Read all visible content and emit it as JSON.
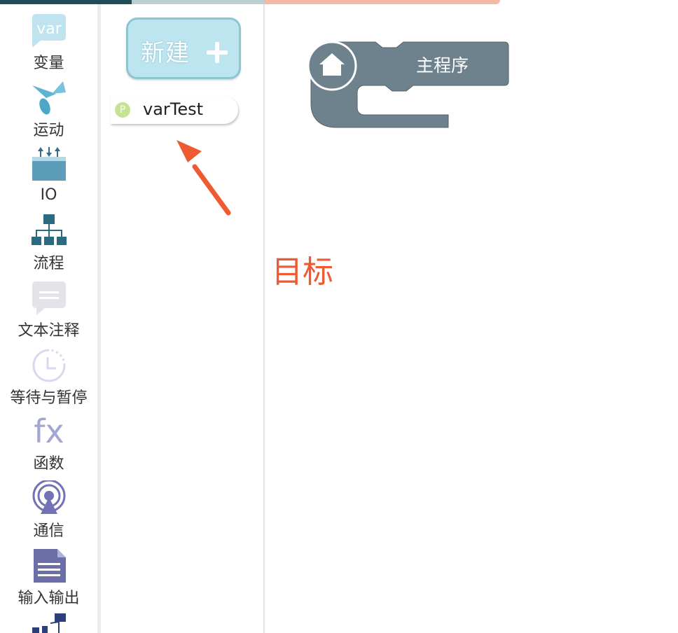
{
  "sidebar": {
    "categories": [
      {
        "label": "变量",
        "icon": "var-icon"
      },
      {
        "label": "运动",
        "icon": "motion-icon"
      },
      {
        "label": "IO",
        "icon": "io-icon"
      },
      {
        "label": "流程",
        "icon": "flow-icon"
      },
      {
        "label": "文本注释",
        "icon": "comment-icon"
      },
      {
        "label": "等待与暂停",
        "icon": "clock-icon"
      },
      {
        "label": "函数",
        "icon": "function-icon"
      },
      {
        "label": "通信",
        "icon": "antenna-icon"
      },
      {
        "label": "输入输出",
        "icon": "document-icon"
      }
    ],
    "var_icon_text": "var",
    "function_icon_text": "fx"
  },
  "palette": {
    "new_button_label": "新建",
    "variable": {
      "badge": "P",
      "name": "varTest"
    }
  },
  "workspace": {
    "main_block_label": "主程序",
    "annotation_label": "目标"
  },
  "colors": {
    "accent": "#ee5a32",
    "block": "#6d828d",
    "new_button_bg": "#bde5ef"
  }
}
